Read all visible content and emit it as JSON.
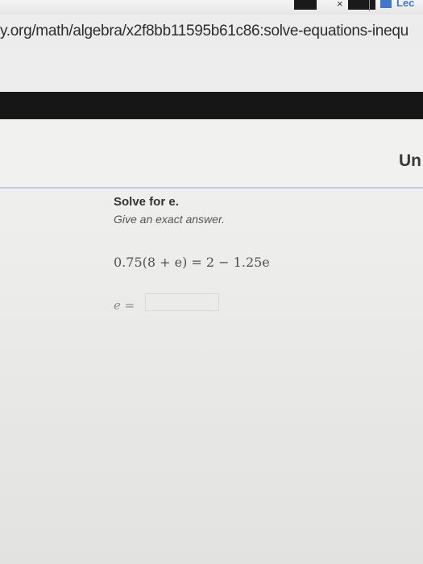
{
  "browser": {
    "url": "y.org/math/algebra/x2f8bb11595b61c86:solve-equations-inequ",
    "tab_close_glyph": "×",
    "extension_label": "Lec"
  },
  "header": {
    "section_label": "Un"
  },
  "problem": {
    "title": "Solve for e.",
    "instruction": "Give an exact answer.",
    "equation": "0.75(8 + e) = 2 − 1.25e",
    "answer_label": "e =",
    "answer_value": ""
  }
}
